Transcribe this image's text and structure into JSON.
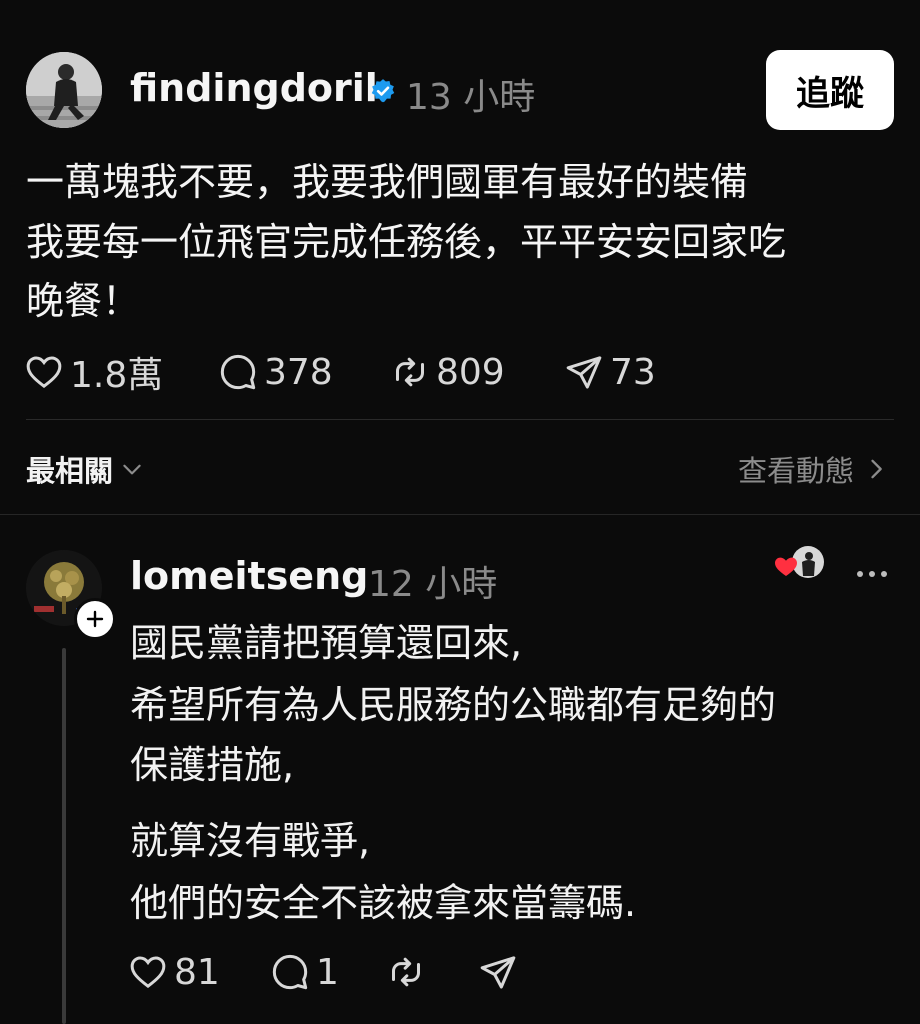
{
  "post": {
    "username": "findingdoril",
    "verified": true,
    "time": "13 小時",
    "follow_label": "追蹤",
    "lines": [
      "一萬塊我不要，我要我們國軍有最好的裝備",
      "我要每一位飛官完成任務後，平平安安回家吃",
      "晚餐！"
    ],
    "stats": {
      "likes": "1.8萬",
      "comments": "378",
      "reposts": "809",
      "shares": "73"
    },
    "icons": {
      "like": "heart-icon",
      "comment": "comment-bubble-icon",
      "repost": "repost-icon",
      "share": "send-icon",
      "verified": "verified-badge-icon"
    },
    "colors": {
      "background": "#0b0b0b",
      "verified": "#1d9bf0",
      "like_active": "#ff3040"
    }
  },
  "sort_bar": {
    "label": "最相關",
    "activity_label": "查看動態"
  },
  "comment": {
    "username": "lomeitseng",
    "time": "12 小時",
    "lines": [
      "國民黨請把預算還回來,",
      "希望所有為人民服務的公職都有足夠的",
      "保護措施,",
      "就算沒有戰爭,",
      "他們的安全不該被拿來當籌碼."
    ],
    "stats": {
      "likes": "81",
      "comments": "1"
    }
  }
}
